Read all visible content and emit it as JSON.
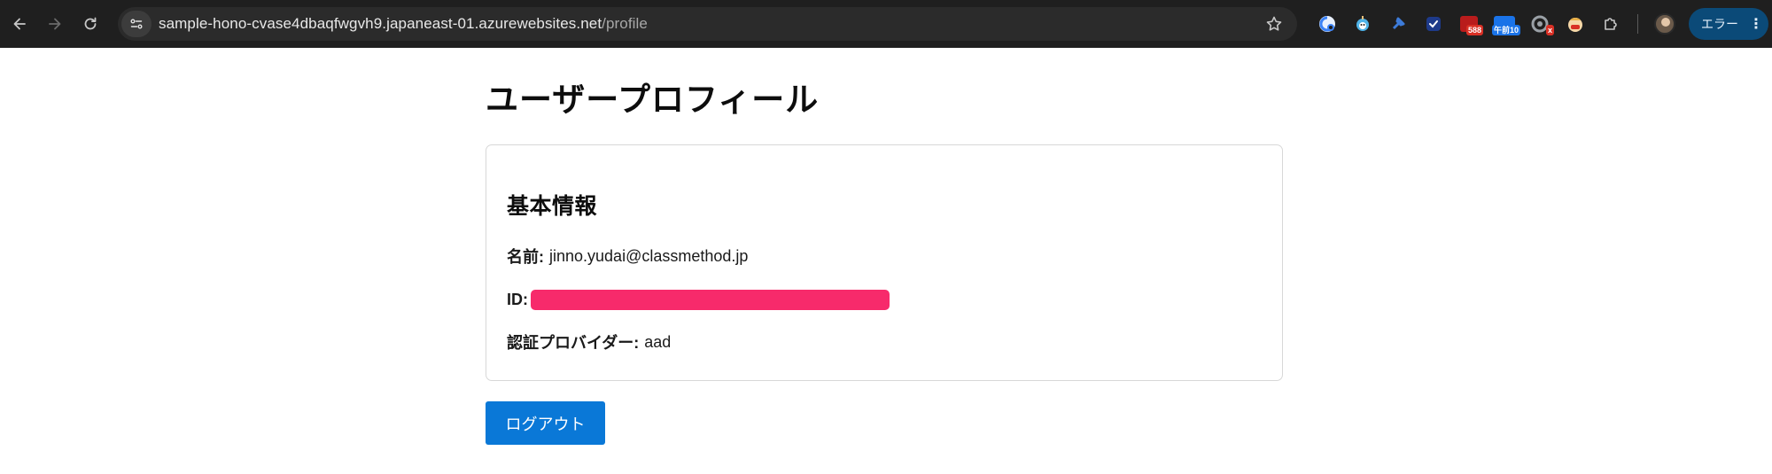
{
  "browser": {
    "url_host": "sample-hono-cvase4dbaqfwgvh9.japaneast-01.azurewebsites.net",
    "url_path": "/profile",
    "extensions": [
      {
        "icon": "pdf-extension-icon",
        "color": "#3b82f6"
      },
      {
        "icon": "robot-extension-icon",
        "color": "#4fb3e8"
      },
      {
        "icon": "pin-extension-icon",
        "color": "#3d7bd9"
      },
      {
        "icon": "check-extension-icon",
        "color": "#2f6fd6"
      },
      {
        "icon": "counter-extension-icon",
        "color": "#d93025",
        "badge": "588"
      },
      {
        "icon": "calendar-extension-icon",
        "color": "#1a73e8",
        "badge": "午前10"
      },
      {
        "icon": "record-extension-icon",
        "color": "#9aa0a6",
        "badge": "x"
      },
      {
        "icon": "mascot-extension-icon",
        "color": "#e8b04a"
      },
      {
        "icon": "puzzle-icon",
        "color": "#c7c7c7"
      }
    ],
    "error_label": "エラー"
  },
  "page": {
    "title": "ユーザープロフィール",
    "section_title": "基本情報",
    "name_label": "名前:",
    "name_value": "jinno.yudai@classmethod.jp",
    "id_label": "ID:",
    "provider_label": "認証プロバイダー:",
    "provider_value": "aad",
    "logout_label": "ログアウト"
  }
}
